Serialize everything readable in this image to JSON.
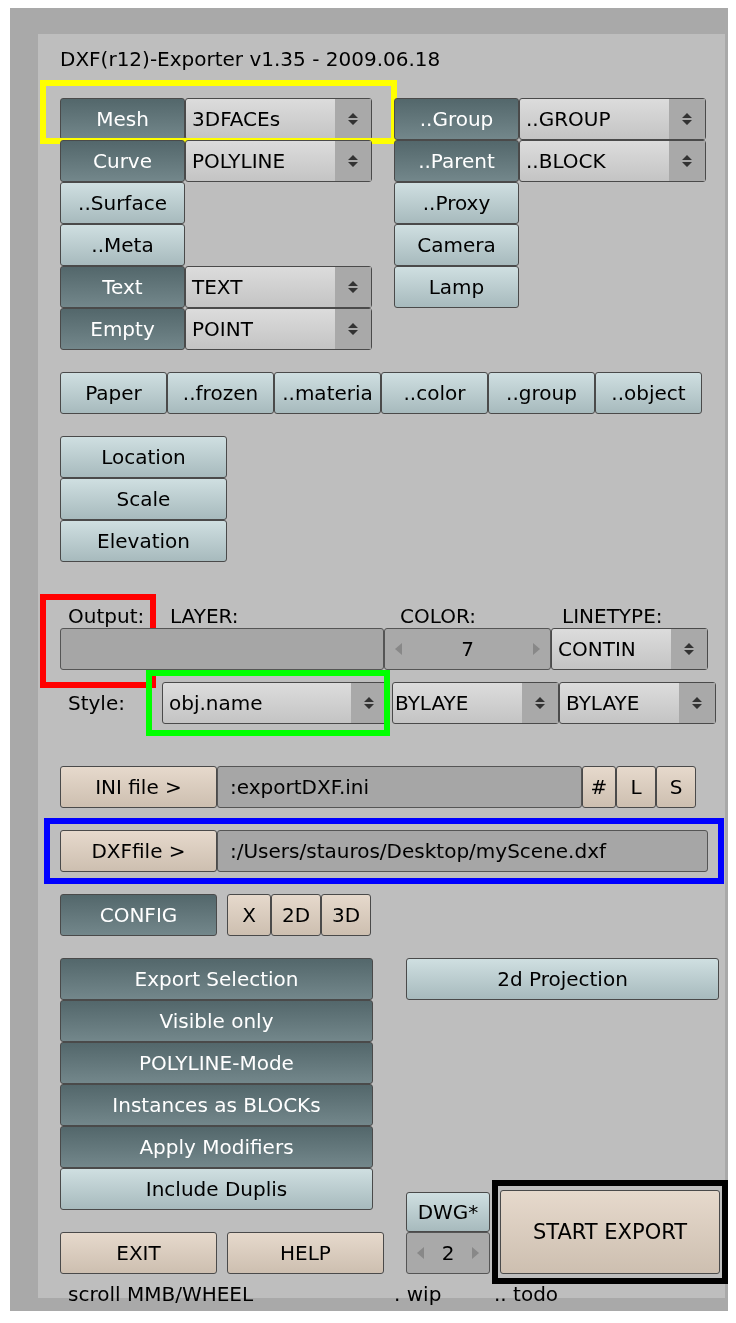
{
  "title": "DXF(r12)-Exporter  v1.35 - 2009.06.18",
  "object_types_left": [
    {
      "label": "Mesh",
      "on": true,
      "value": "3DFACEs",
      "highlight": {
        "color": "#ffff00"
      }
    },
    {
      "label": "Curve",
      "on": true,
      "value": "POLYLINE"
    },
    {
      "label": "..Surface",
      "on": false
    },
    {
      "label": "..Meta",
      "on": false
    },
    {
      "label": "Text",
      "on": true,
      "value": "TEXT"
    },
    {
      "label": "Empty",
      "on": true,
      "value": "POINT"
    }
  ],
  "object_types_right": [
    {
      "label": "..Group",
      "on": true,
      "value": "..GROUP"
    },
    {
      "label": "..Parent",
      "on": true,
      "value": "..BLOCK"
    },
    {
      "label": "..Proxy",
      "on": false
    },
    {
      "label": "Camera",
      "on": false
    },
    {
      "label": "Lamp",
      "on": false
    }
  ],
  "layer_filters": [
    {
      "label": "Paper",
      "on": false
    },
    {
      "label": "..frozen",
      "on": false
    },
    {
      "label": "..materia",
      "on": false
    },
    {
      "label": "..color",
      "on": false
    },
    {
      "label": "..group",
      "on": false
    },
    {
      "label": "..object",
      "on": false
    }
  ],
  "transforms": [
    {
      "label": "Location",
      "on": false
    },
    {
      "label": "Scale",
      "on": false
    },
    {
      "label": "Elevation",
      "on": false
    }
  ],
  "output": {
    "label": "Output:",
    "highlight": {
      "color": "#ff0000"
    },
    "headers": [
      "LAYER:",
      "COLOR:",
      "LINETYPE:"
    ],
    "color_value": "7",
    "linetype": "CONTIN",
    "style_label": "Style:",
    "style": {
      "value": "obj.name",
      "highlight": {
        "color": "#00ff00"
      }
    },
    "style_color": "BYLAYE",
    "style_linetype": "BYLAYE"
  },
  "ini": {
    "button": "INI file >",
    "value": ":exportDXF.ini",
    "buttons": [
      "#",
      "L",
      "S"
    ]
  },
  "dxf": {
    "button": "DXFfile >",
    "value": ":/Users/stauros/Desktop/myScene.dxf",
    "highlight": {
      "color": "#0000ff"
    }
  },
  "config": {
    "label": "CONFIG",
    "on": true,
    "buttons": [
      "X",
      "2D",
      "3D"
    ]
  },
  "options": [
    {
      "label": "Export Selection",
      "on": true
    },
    {
      "label": "Visible only",
      "on": true
    },
    {
      "label": "POLYLINE-Mode",
      "on": true
    },
    {
      "label": "Instances as BLOCKs",
      "on": true
    },
    {
      "label": "Apply Modifiers",
      "on": true
    },
    {
      "label": "Include Duplis",
      "on": false
    }
  ],
  "projection": {
    "label": "2d Projection",
    "on": false
  },
  "dwg": {
    "label": "DWG*",
    "on": false,
    "counter": "2"
  },
  "start_export": {
    "label": "START EXPORT",
    "highlight": {
      "color": "#000000"
    }
  },
  "exit": "EXIT",
  "help": "HELP",
  "footer": [
    "scroll MMB/WHEEL",
    ". wip",
    ".. todo"
  ]
}
